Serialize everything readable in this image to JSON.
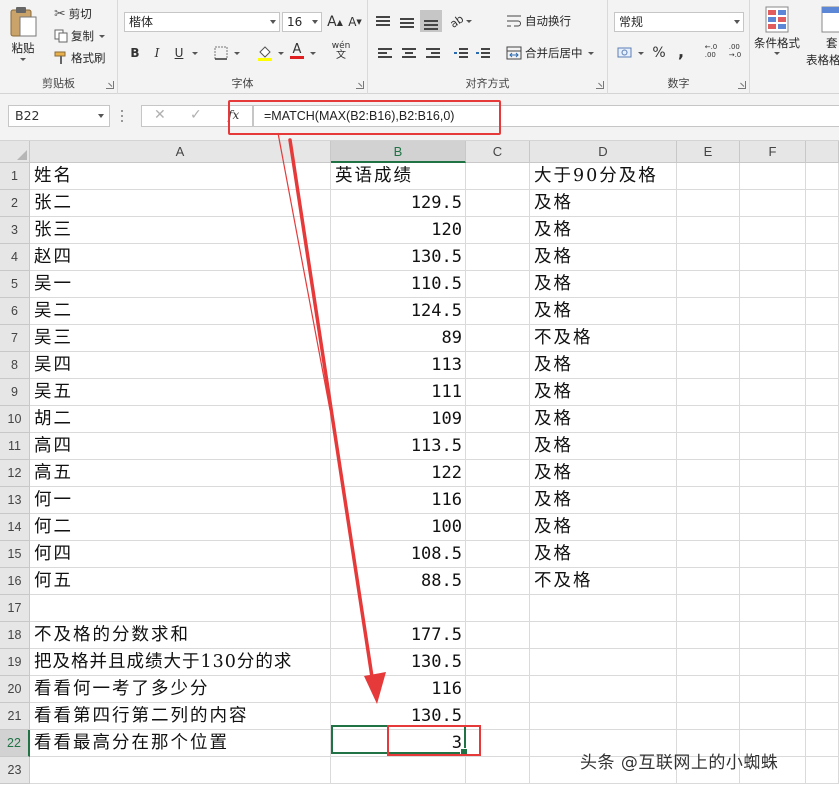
{
  "ribbon": {
    "clipboard": {
      "paste": "粘贴",
      "cut": "剪切",
      "copy": "复制",
      "format_painter": "格式刷",
      "label": "剪贴板"
    },
    "font": {
      "name": "楷体",
      "size": "16",
      "grow": "A",
      "shrink": "A",
      "bold": "B",
      "italic": "I",
      "underline": "U",
      "label": "字体",
      "phonetic": "wén"
    },
    "alignment": {
      "wrap": "自动换行",
      "merge": "合并后居中",
      "label": "对齐方式"
    },
    "number": {
      "format": "常规",
      "percent": "%",
      "comma": ",",
      "label": "数字"
    },
    "styles": {
      "conditional": "条件格式",
      "table_top": "套",
      "table": "表格格"
    }
  },
  "formula_bar": {
    "name_box": "B22",
    "cancel": "✕",
    "enter": "✓",
    "fx": "fx",
    "formula": "=MATCH(MAX(B2:B16),B2:B16,0)"
  },
  "columns": [
    "A",
    "B",
    "C",
    "D",
    "E",
    "F"
  ],
  "selected_column": "B",
  "selected_row": 22,
  "rows": [
    {
      "n": "1",
      "a": "姓名",
      "b": "英语成绩",
      "d": "大于90分及格"
    },
    {
      "n": "2",
      "a": "张二",
      "b": "129.5",
      "d": "及格"
    },
    {
      "n": "3",
      "a": "张三",
      "b": "120",
      "d": "及格"
    },
    {
      "n": "4",
      "a": "赵四",
      "b": "130.5",
      "d": "及格"
    },
    {
      "n": "5",
      "a": "吴一",
      "b": "110.5",
      "d": "及格"
    },
    {
      "n": "6",
      "a": "吴二",
      "b": "124.5",
      "d": "及格"
    },
    {
      "n": "7",
      "a": "吴三",
      "b": "89",
      "d": "不及格"
    },
    {
      "n": "8",
      "a": "吴四",
      "b": "113",
      "d": "及格"
    },
    {
      "n": "9",
      "a": "吴五",
      "b": "111",
      "d": "及格"
    },
    {
      "n": "10",
      "a": "胡二",
      "b": "109",
      "d": "及格"
    },
    {
      "n": "11",
      "a": "高四",
      "b": "113.5",
      "d": "及格"
    },
    {
      "n": "12",
      "a": "高五",
      "b": "122",
      "d": "及格"
    },
    {
      "n": "13",
      "a": "何一",
      "b": "116",
      "d": "及格"
    },
    {
      "n": "14",
      "a": "何二",
      "b": "100",
      "d": "及格"
    },
    {
      "n": "15",
      "a": "何四",
      "b": "108.5",
      "d": "及格"
    },
    {
      "n": "16",
      "a": "何五",
      "b": "88.5",
      "d": "不及格"
    },
    {
      "n": "17",
      "a": "",
      "b": "",
      "d": ""
    },
    {
      "n": "18",
      "a": "不及格的分数求和",
      "b": "177.5",
      "d": ""
    },
    {
      "n": "19",
      "a": "把及格并且成绩大于130分的求",
      "b": "130.5",
      "d": ""
    },
    {
      "n": "20",
      "a": "看看何一考了多少分",
      "b": "116",
      "d": ""
    },
    {
      "n": "21",
      "a": "看看第四行第二列的内容",
      "b": "130.5",
      "d": ""
    },
    {
      "n": "22",
      "a": "看看最高分在那个位置",
      "b": "3",
      "d": ""
    },
    {
      "n": "23",
      "a": "",
      "b": "",
      "d": ""
    }
  ],
  "watermark": "头条 @互联网上的小蜘蛛",
  "colors": {
    "accent_green": "#217346",
    "annotation_red": "#e63a3a"
  }
}
